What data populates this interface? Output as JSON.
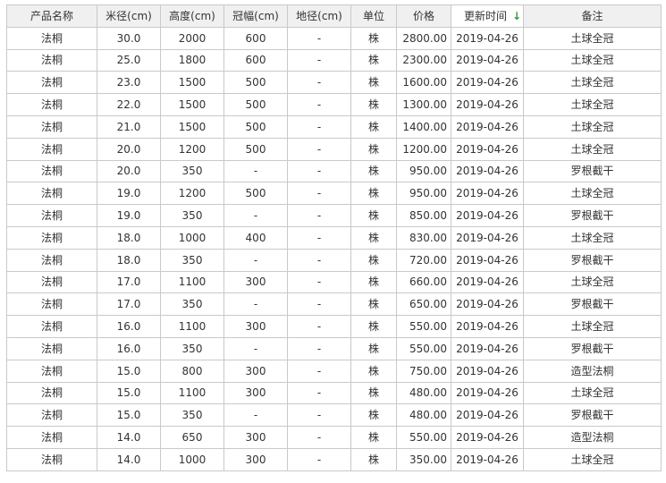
{
  "table": {
    "columns": [
      {
        "key": "name",
        "label": "产品名称"
      },
      {
        "key": "diameter",
        "label": "米径(cm)"
      },
      {
        "key": "height",
        "label": "高度(cm)"
      },
      {
        "key": "crown",
        "label": "冠幅(cm)"
      },
      {
        "key": "ground_diameter",
        "label": "地径(cm)"
      },
      {
        "key": "unit",
        "label": "单位"
      },
      {
        "key": "price",
        "label": "价格"
      },
      {
        "key": "updated",
        "label": "更新时间",
        "sort": "desc",
        "sort_icon": "sort-down-arrow-icon"
      },
      {
        "key": "note",
        "label": "备注"
      }
    ],
    "rows": [
      [
        "法桐",
        "30.0",
        "2000",
        "600",
        "-",
        "株",
        "2800.00",
        "2019-04-26",
        "土球全冠"
      ],
      [
        "法桐",
        "25.0",
        "1800",
        "600",
        "-",
        "株",
        "2300.00",
        "2019-04-26",
        "土球全冠"
      ],
      [
        "法桐",
        "23.0",
        "1500",
        "500",
        "-",
        "株",
        "1600.00",
        "2019-04-26",
        "土球全冠"
      ],
      [
        "法桐",
        "22.0",
        "1500",
        "500",
        "-",
        "株",
        "1300.00",
        "2019-04-26",
        "土球全冠"
      ],
      [
        "法桐",
        "21.0",
        "1500",
        "500",
        "-",
        "株",
        "1400.00",
        "2019-04-26",
        "土球全冠"
      ],
      [
        "法桐",
        "20.0",
        "1200",
        "500",
        "-",
        "株",
        "1200.00",
        "2019-04-26",
        "土球全冠"
      ],
      [
        "法桐",
        "20.0",
        "350",
        "-",
        "-",
        "株",
        "950.00",
        "2019-04-26",
        "罗根截干"
      ],
      [
        "法桐",
        "19.0",
        "1200",
        "500",
        "-",
        "株",
        "950.00",
        "2019-04-26",
        "土球全冠"
      ],
      [
        "法桐",
        "19.0",
        "350",
        "-",
        "-",
        "株",
        "850.00",
        "2019-04-26",
        "罗根截干"
      ],
      [
        "法桐",
        "18.0",
        "1000",
        "400",
        "-",
        "株",
        "830.00",
        "2019-04-26",
        "土球全冠"
      ],
      [
        "法桐",
        "18.0",
        "350",
        "-",
        "-",
        "株",
        "720.00",
        "2019-04-26",
        "罗根截干"
      ],
      [
        "法桐",
        "17.0",
        "1100",
        "300",
        "-",
        "株",
        "660.00",
        "2019-04-26",
        "土球全冠"
      ],
      [
        "法桐",
        "17.0",
        "350",
        "-",
        "-",
        "株",
        "650.00",
        "2019-04-26",
        "罗根截干"
      ],
      [
        "法桐",
        "16.0",
        "1100",
        "300",
        "-",
        "株",
        "550.00",
        "2019-04-26",
        "土球全冠"
      ],
      [
        "法桐",
        "16.0",
        "350",
        "-",
        "-",
        "株",
        "550.00",
        "2019-04-26",
        "罗根截干"
      ],
      [
        "法桐",
        "15.0",
        "800",
        "300",
        "-",
        "株",
        "750.00",
        "2019-04-26",
        "造型法桐"
      ],
      [
        "法桐",
        "15.0",
        "1100",
        "300",
        "-",
        "株",
        "480.00",
        "2019-04-26",
        "土球全冠"
      ],
      [
        "法桐",
        "15.0",
        "350",
        "-",
        "-",
        "株",
        "480.00",
        "2019-04-26",
        "罗根截干"
      ],
      [
        "法桐",
        "14.0",
        "650",
        "300",
        "-",
        "株",
        "550.00",
        "2019-04-26",
        "造型法桐"
      ],
      [
        "法桐",
        "14.0",
        "1000",
        "300",
        "-",
        "株",
        "350.00",
        "2019-04-26",
        "土球全冠"
      ]
    ]
  },
  "colors": {
    "header_bg": "#f0f0f0",
    "border": "#c9c9c9",
    "text": "#333333",
    "sort_arrow": "#2f9a3a"
  }
}
